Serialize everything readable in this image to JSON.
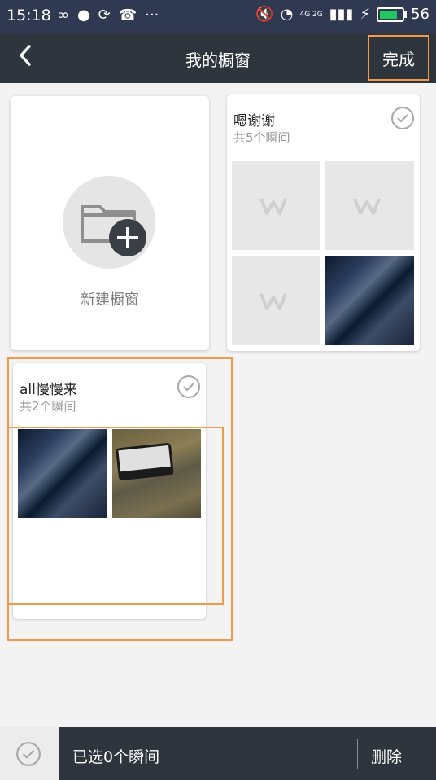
{
  "status_bar": {
    "time": "15:18",
    "battery_level": "56",
    "network_label": "4G 2G"
  },
  "header": {
    "title": "我的橱窗",
    "done_label": "完成"
  },
  "new_showcase": {
    "label": "新建橱窗"
  },
  "showcases": [
    {
      "name": "嗯谢谢",
      "count": "共5个瞬间"
    },
    {
      "name": "all慢慢来",
      "count": "共2个瞬间"
    }
  ],
  "footer": {
    "selected_text": "已选0个瞬间",
    "delete_label": "删除"
  },
  "colors": {
    "header_bg": "#2f353d",
    "status_bg": "#2f3a52",
    "highlight": "#f29a4a"
  }
}
